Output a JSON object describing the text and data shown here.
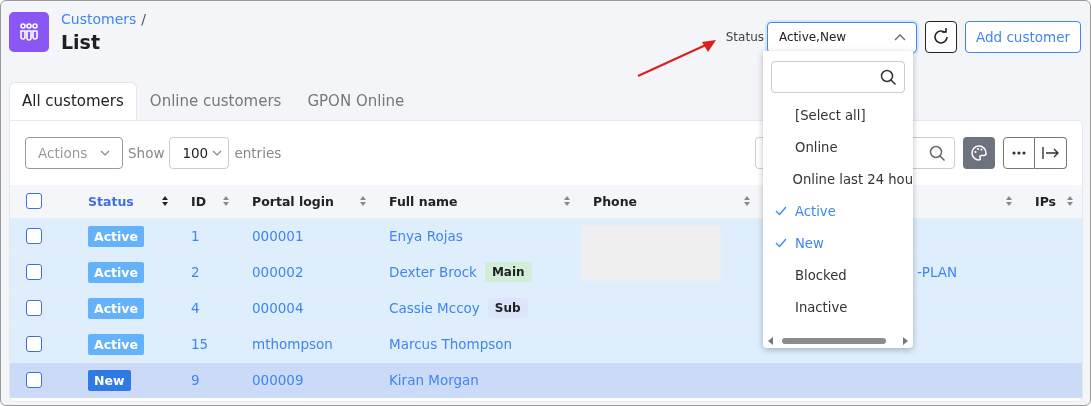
{
  "breadcrumb": {
    "parent": "Customers",
    "separator": "/",
    "title": "List"
  },
  "status_filter": {
    "label": "Status",
    "value": "Active,New",
    "expanded": true,
    "options": [
      {
        "label": "[Select all]",
        "checked": false
      },
      {
        "label": "Online",
        "checked": false
      },
      {
        "label": "Online last 24 hou",
        "checked": false
      },
      {
        "label": "Active",
        "checked": true
      },
      {
        "label": "New",
        "checked": true
      },
      {
        "label": "Blocked",
        "checked": false
      },
      {
        "label": "Inactive",
        "checked": false
      }
    ]
  },
  "add_button": "Add customer",
  "tabs": [
    {
      "label": "All customers",
      "selected": true
    },
    {
      "label": "Online customers",
      "selected": false
    },
    {
      "label": "GPON Online",
      "selected": false
    }
  ],
  "toolbar": {
    "actions": "Actions",
    "show": "Show",
    "entries_value": "100",
    "entries": "entries"
  },
  "table": {
    "select_all_checked": false,
    "phone_redacted": true,
    "columns": [
      {
        "label": "Status",
        "sorted": true
      },
      {
        "label": "ID",
        "sorted": false
      },
      {
        "label": "Portal login",
        "sorted": false
      },
      {
        "label": "Full name",
        "sorted": false
      },
      {
        "label": "Phone",
        "sorted": false
      },
      {
        "sorted": false
      },
      {
        "label": "IPs",
        "sorted": false
      }
    ],
    "rows": [
      {
        "checked": false,
        "hovered": false,
        "status": {
          "label": "Active",
          "color": "#64b2fa"
        },
        "id": "1",
        "login": "000001",
        "name": "Enya Rojas"
      },
      {
        "checked": false,
        "hovered": false,
        "status": {
          "label": "Active",
          "color": "#64b2fa"
        },
        "id": "2",
        "login": "000002",
        "name": "Dexter Brock",
        "tag": {
          "label": "Main",
          "color": "#d3eed8"
        },
        "column_7": "-PLAN"
      },
      {
        "checked": false,
        "hovered": false,
        "status": {
          "label": "Active",
          "color": "#64b2fa"
        },
        "id": "4",
        "login": "000004",
        "name": "Cassie Mccoy",
        "tag": {
          "label": "Sub",
          "color": "#dce5fa"
        }
      },
      {
        "checked": false,
        "hovered": false,
        "status": {
          "label": "Active",
          "color": "#64b2fa"
        },
        "id": "15",
        "login": "mthompson",
        "name": "Marcus Thompson"
      },
      {
        "checked": false,
        "hovered": true,
        "status": {
          "label": "New",
          "color": "#2f7ae5"
        },
        "id": "9",
        "login": "000009",
        "name": "Kiran Morgan"
      }
    ]
  }
}
